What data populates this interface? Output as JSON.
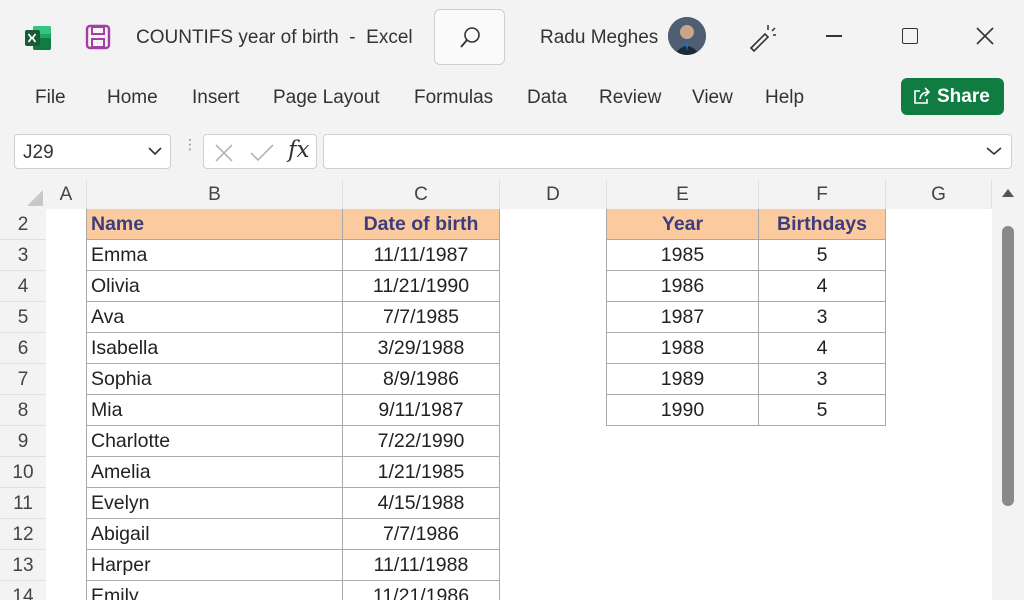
{
  "window": {
    "title": "COUNTIFS year of birth  -  Excel",
    "user_name": "Radu Meghes"
  },
  "ribbon": {
    "tabs": [
      "File",
      "Home",
      "Insert",
      "Page Layout",
      "Formulas",
      "Data",
      "Review",
      "View",
      "Help"
    ],
    "share_label": "Share"
  },
  "formula_bar": {
    "name_box": "J29",
    "fx_label": "fx",
    "formula": ""
  },
  "grid": {
    "columns": [
      "A",
      "B",
      "C",
      "D",
      "E",
      "F",
      "G"
    ],
    "rows": [
      "2",
      "3",
      "4",
      "5",
      "6",
      "7",
      "8",
      "9",
      "10",
      "11",
      "12",
      "13",
      "14"
    ],
    "names_table": {
      "headers": [
        "Name",
        "Date of birth"
      ],
      "rows": [
        [
          "Emma",
          "11/11/1987"
        ],
        [
          "Olivia",
          "11/21/1990"
        ],
        [
          "Ava",
          "7/7/1985"
        ],
        [
          "Isabella",
          "3/29/1988"
        ],
        [
          "Sophia",
          "8/9/1986"
        ],
        [
          "Mia",
          "9/11/1987"
        ],
        [
          "Charlotte",
          "7/22/1990"
        ],
        [
          "Amelia",
          "1/21/1985"
        ],
        [
          "Evelyn",
          "4/15/1988"
        ],
        [
          "Abigail",
          "7/7/1986"
        ],
        [
          "Harper",
          "11/11/1988"
        ],
        [
          "Emily",
          "11/21/1986"
        ]
      ]
    },
    "summary_table": {
      "headers": [
        "Year",
        "Birthdays"
      ],
      "rows": [
        [
          "1985",
          "5"
        ],
        [
          "1986",
          "4"
        ],
        [
          "1987",
          "3"
        ],
        [
          "1988",
          "4"
        ],
        [
          "1989",
          "3"
        ],
        [
          "1990",
          "5"
        ]
      ]
    }
  },
  "colors": {
    "header_fill": "#fbcb9f",
    "header_text": "#3d3d7a",
    "share_green": "#107c41",
    "excel_green": "#1e7145",
    "save_purple": "#a43ea2"
  }
}
